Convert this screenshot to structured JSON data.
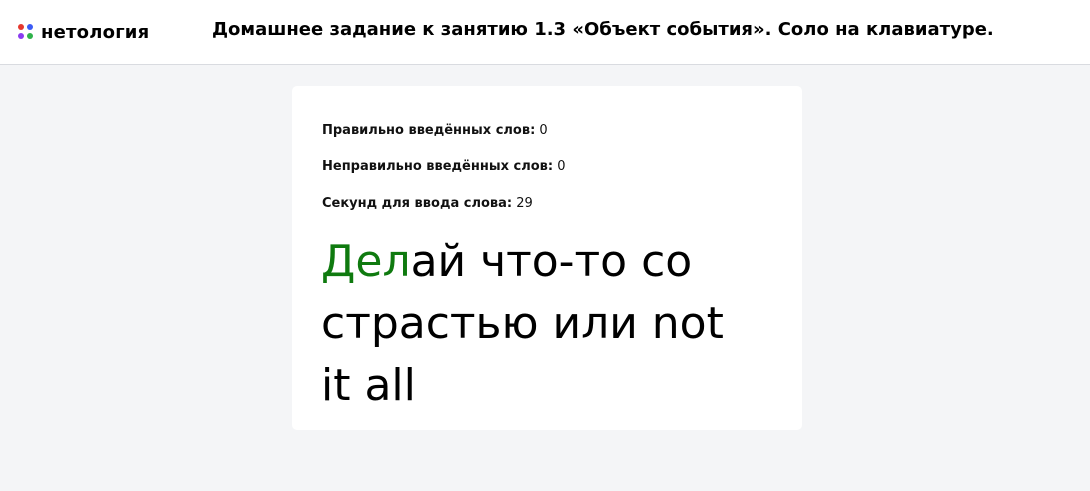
{
  "header": {
    "logo_text": "нетология",
    "title": "Домашнее задание к занятию 1.3 «Объект события». Соло на клавиатуре."
  },
  "logo_colors": [
    "#e5382e",
    "#3b5bf5",
    "#8a3cf0",
    "#2fb24a"
  ],
  "status": {
    "correct_label": "Правильно введённых слов:",
    "correct_value": "0",
    "wrong_label": "Неправильно введённых слов:",
    "wrong_value": "0",
    "seconds_label": "Секунд для ввода слова:",
    "seconds_value": "29"
  },
  "phrase": {
    "typed": "Дел",
    "remaining": "ай что-то со страстью или not it all"
  },
  "colors": {
    "typed": "#0f7a0f",
    "background": "#f4f5f7"
  }
}
